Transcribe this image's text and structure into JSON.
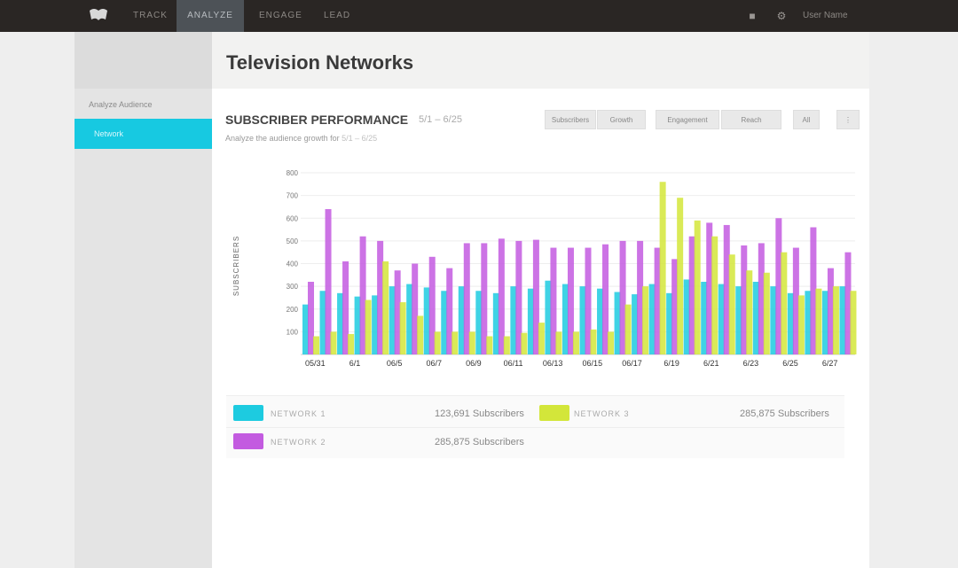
{
  "topnav": {
    "items": [
      "TRACK",
      "ANALYZE",
      "ENGAGE",
      "LEAD"
    ],
    "active_index": 1,
    "user": "User Name"
  },
  "sidebar": {
    "label": "Analyze Audience",
    "active_item": "Network"
  },
  "page": {
    "title": "Television Networks"
  },
  "panel": {
    "title": "SUBSCRIBER PERFORMANCE",
    "range": "5/1 – 6/25",
    "subtitle_prefix": "Analyze the audience growth for",
    "subtitle_range": "5/1 – 6/25",
    "buttons": [
      "Subscribers",
      "Growth",
      "Engagement",
      "Reach",
      "All"
    ]
  },
  "chart_data": {
    "type": "bar",
    "ylabel": "SUBSCRIBERS",
    "ylim": [
      0,
      800
    ],
    "yticks": [
      "100",
      "200",
      "300",
      "400",
      "500",
      "600",
      "700",
      "800"
    ],
    "x_labels": [
      "05/31",
      "6/1",
      "06/5",
      "06/7",
      "06/9",
      "06/11",
      "06/13",
      "06/15",
      "06/17",
      "6/19",
      "6/21",
      "6/23",
      "6/25",
      "6/27"
    ],
    "colors": {
      "network1": "#1dcbe0",
      "network2": "#c35be0",
      "network3": "#d3e63a"
    },
    "series": [
      {
        "name": "NETWORK 1",
        "values": [
          220,
          280,
          270,
          255,
          260,
          300,
          310,
          295,
          280,
          300,
          280,
          270,
          300,
          290,
          325,
          310,
          300,
          290,
          275,
          265,
          310,
          270,
          330,
          320,
          310,
          300,
          320,
          300,
          270,
          280,
          280,
          300
        ]
      },
      {
        "name": "NETWORK 2",
        "values": [
          320,
          640,
          410,
          520,
          500,
          370,
          400,
          430,
          380,
          490,
          490,
          510,
          500,
          505,
          470,
          470,
          470,
          485,
          500,
          500,
          470,
          420,
          520,
          580,
          570,
          480,
          490,
          600,
          470,
          560,
          380,
          450
        ]
      },
      {
        "name": "NETWORK 3",
        "values": [
          80,
          100,
          90,
          240,
          410,
          230,
          170,
          100,
          100,
          100,
          80,
          80,
          95,
          140,
          100,
          100,
          110,
          100,
          220,
          300,
          760,
          690,
          590,
          520,
          440,
          370,
          360,
          450,
          260,
          290,
          300,
          280
        ]
      }
    ]
  },
  "legend": {
    "rows": [
      [
        {
          "name": "NETWORK 1",
          "color": "#1dcbe0",
          "value": "123,691 Subscribers"
        },
        {
          "name": "NETWORK 3",
          "color": "#d3e63a",
          "value": "285,875 Subscribers"
        }
      ],
      [
        {
          "name": "NETWORK 2",
          "color": "#c35be0",
          "value": "285,875 Subscribers"
        }
      ]
    ]
  }
}
